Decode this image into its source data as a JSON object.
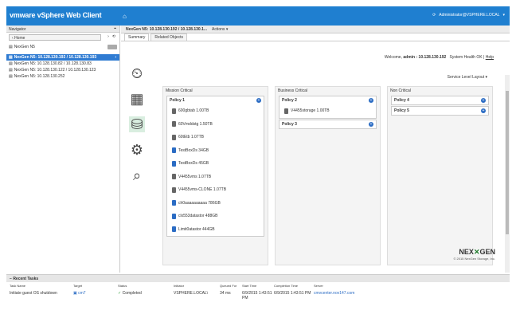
{
  "app": {
    "brand": "vmware",
    "title": "vSphere Web Client",
    "home_icon": "home-icon",
    "refresh_icon": "refresh-icon",
    "user": "Administrator@VSPHERE.LOCAL"
  },
  "navigator": {
    "title": "Navigator",
    "home_label": "Home",
    "items": [
      {
        "label": "NexGen N5",
        "icon": "storage-icon"
      },
      {
        "label": "NexGen N5: 10.128.130.192 / 10.128.130.193",
        "icon": "storage-icon",
        "selected": true
      },
      {
        "label": "NexGen N5: 10.128.130.82 / 10.128.130.83",
        "icon": "storage-icon"
      },
      {
        "label": "NexGen N5: 10.128.130.122 / 10.128.130.123",
        "icon": "storage-icon"
      },
      {
        "label": "NexGen N5: 10.128.130.252",
        "icon": "storage-icon"
      }
    ]
  },
  "objectbar": {
    "title": "NexGen N5: 10.128.130.192 / 10.128.130.1...",
    "actions": "Actions"
  },
  "tabs": [
    "Summary",
    "Related Objects"
  ],
  "welcome": {
    "prefix": "Welcome,",
    "user": "admin : 10.128.130.192",
    "health": "System Health OK",
    "help": "Help"
  },
  "service_level": "Service Level Layout",
  "columns": [
    {
      "title": "Mission Critical",
      "policies": [
        {
          "name": "Policy 1",
          "volumes": [
            {
              "label": "600gbtab 1.00TB",
              "color": "gray"
            },
            {
              "label": "60Vmddstg 1.50TB",
              "color": "gray"
            },
            {
              "label": "60tEtb 1.07TB",
              "color": "gray"
            },
            {
              "label": "TestBoxDs 34GB",
              "color": "blue"
            },
            {
              "label": "TestBoxDs 45GB",
              "color": "blue"
            },
            {
              "label": "V4455vms 1.07TB",
              "color": "gray"
            },
            {
              "label": "V4455vms-CLONE 1.07TB",
              "color": "gray"
            },
            {
              "label": "ch0aaaaaaaaaa 786GB",
              "color": "blue"
            },
            {
              "label": "clx553datastor 488GB",
              "color": "blue"
            },
            {
              "label": "Limit0atastor 444GB",
              "color": "blue"
            }
          ]
        }
      ]
    },
    {
      "title": "Business Critical",
      "policies": [
        {
          "name": "Policy 2",
          "volumes": [
            {
              "label": "V4455storage 1.00TB",
              "color": "gray"
            }
          ]
        },
        {
          "name": "Policy 3",
          "volumes": []
        }
      ]
    },
    {
      "title": "Non Critical",
      "policies": [
        {
          "name": "Policy 4",
          "volumes": []
        },
        {
          "name": "Policy 5",
          "volumes": []
        }
      ]
    }
  ],
  "logo": {
    "left": "NEX",
    "right": "GEN",
    "copyright": "© 2015 NexGen Storage, Inc."
  },
  "recent_tasks": {
    "title": "Recent Tasks",
    "columns": [
      "Task Name",
      "Target",
      "Status",
      "Initiator",
      "Queued For",
      "Start Time",
      "Completion Time",
      "Server"
    ],
    "rows": [
      {
        "task": "Initiate guest OS shutdown",
        "target": "cm7",
        "status": "Completed",
        "initiator": "VSPHERE.LOCAL\\",
        "queued": "34 ms",
        "start": "6/9/2015 1:43:51 PM",
        "complete": "6/9/2015 1:43:51 PM",
        "server": "cmvcenter.nov147.com"
      }
    ]
  }
}
